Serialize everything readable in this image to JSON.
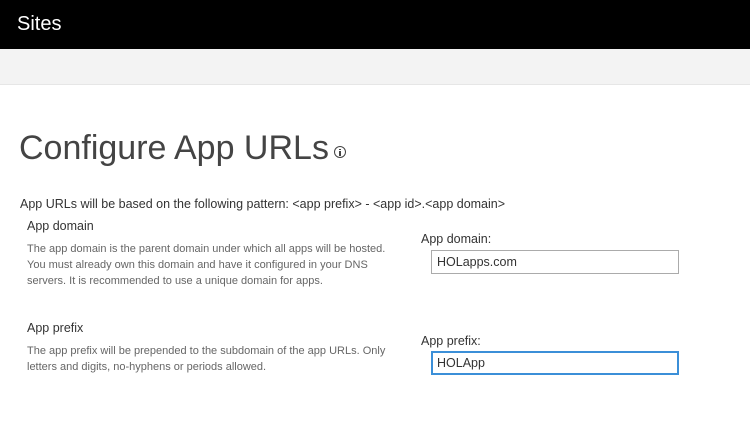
{
  "header": {
    "title": "Sites"
  },
  "page": {
    "title": "Configure App URLs",
    "info_icon": "info-icon",
    "pattern_text": "App URLs will be based on the following pattern: <app prefix> - <app id>.<app domain>"
  },
  "app_domain_section": {
    "title": "App domain",
    "description": "The app domain is the parent domain under which all apps will be hosted. You must already own this domain and have it configured in your DNS servers. It is recommended to use a unique domain for apps.",
    "field_label": "App domain:",
    "value": "HOLapps.com"
  },
  "app_prefix_section": {
    "title": "App prefix",
    "description": "The app prefix will be prepended to the subdomain of the app URLs. Only letters and digits, no-hyphens or periods allowed.",
    "field_label": "App prefix:",
    "value": "HOLApp"
  },
  "colors": {
    "topbar": "#000000",
    "ribbon": "#f3f3f3",
    "focus_border": "#3b8fd8"
  }
}
